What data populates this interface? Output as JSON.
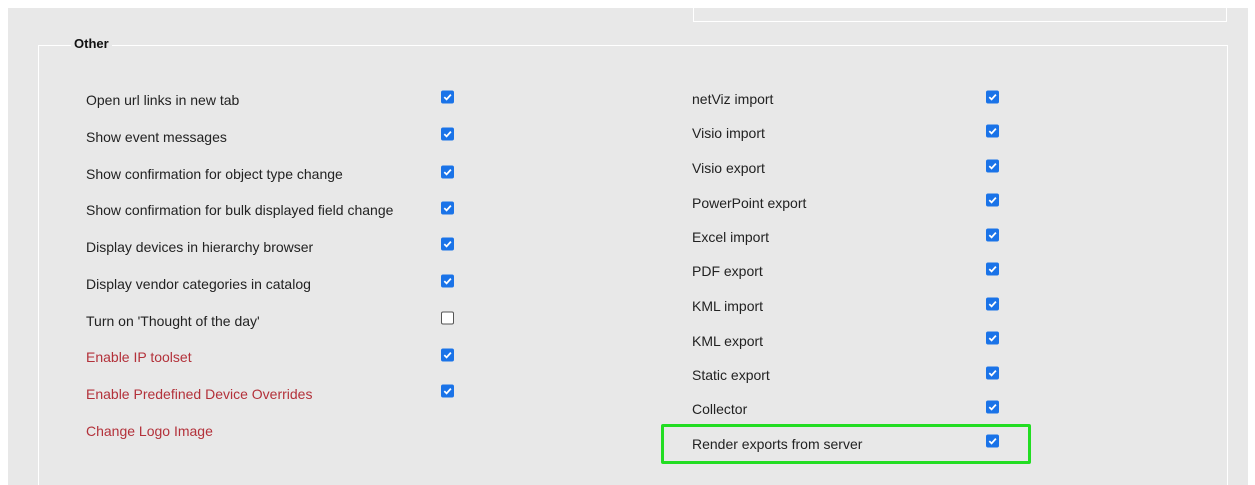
{
  "section": {
    "legend": "Other"
  },
  "left_items": [
    {
      "label": "Open url links in new tab",
      "checked": true,
      "style": "normal"
    },
    {
      "label": "Show event messages",
      "checked": true,
      "style": "normal"
    },
    {
      "label": "Show confirmation for object type change",
      "checked": true,
      "style": "normal"
    },
    {
      "label": "Show confirmation for bulk displayed field change",
      "checked": true,
      "style": "normal"
    },
    {
      "label": "Display devices in hierarchy browser",
      "checked": true,
      "style": "normal"
    },
    {
      "label": "Display vendor categories in catalog",
      "checked": true,
      "style": "normal"
    },
    {
      "label": "Turn on 'Thought of the day'",
      "checked": false,
      "style": "normal"
    },
    {
      "label": "Enable IP toolset",
      "checked": true,
      "style": "link"
    },
    {
      "label": "Enable Predefined Device Overrides",
      "checked": true,
      "style": "link"
    },
    {
      "label": "Change Logo Image",
      "style": "link"
    }
  ],
  "right_items": [
    {
      "label": "netViz import",
      "checked": true
    },
    {
      "label": "Visio import",
      "checked": true
    },
    {
      "label": "Visio export",
      "checked": true
    },
    {
      "label": "PowerPoint export",
      "checked": true
    },
    {
      "label": "Excel import",
      "checked": true
    },
    {
      "label": "PDF export",
      "checked": true
    },
    {
      "label": "KML import",
      "checked": true
    },
    {
      "label": "KML export",
      "checked": true
    },
    {
      "label": "Static export",
      "checked": true
    },
    {
      "label": "Collector",
      "checked": true
    },
    {
      "label": "Render exports from server",
      "checked": true,
      "highlighted": true
    }
  ],
  "colors": {
    "panel_background": "#e8e8e8",
    "checkbox_accent": "#1a73e8",
    "link_text": "#b3313a",
    "highlight_border": "#22dd22"
  },
  "icons": {
    "checkbox_check": "checkmark-icon"
  }
}
